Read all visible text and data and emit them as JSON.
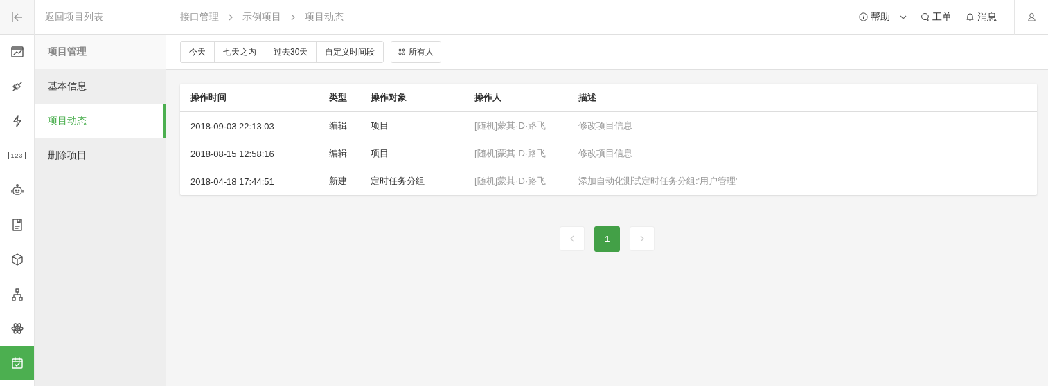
{
  "rail": {
    "items": [
      {
        "kind": "chart",
        "selected": false,
        "divider_before": false
      },
      {
        "kind": "plug",
        "selected": false,
        "divider_before": false
      },
      {
        "kind": "bolt",
        "selected": false,
        "divider_before": false
      },
      {
        "kind": "number",
        "text": "123",
        "selected": false,
        "divider_before": false
      },
      {
        "kind": "robot",
        "selected": false,
        "divider_before": false
      },
      {
        "kind": "document",
        "selected": false,
        "divider_before": false
      },
      {
        "kind": "cube",
        "selected": false,
        "divider_before": false
      },
      {
        "kind": "hierarchy",
        "selected": false,
        "divider_before": true
      },
      {
        "kind": "atom",
        "selected": false,
        "divider_before": false
      },
      {
        "kind": "calendar",
        "selected": true,
        "divider_before": false
      }
    ]
  },
  "back_link": "返回项目列表",
  "menu": {
    "title": "项目管理",
    "items": [
      {
        "label": "基本信息",
        "selected": false
      },
      {
        "label": "项目动态",
        "selected": true
      },
      {
        "label": "删除项目",
        "selected": false
      }
    ]
  },
  "breadcrumb": [
    "接口管理",
    "示例项目",
    "项目动态"
  ],
  "header_actions": [
    {
      "kind": "help",
      "label": "帮助"
    },
    {
      "kind": "ticket",
      "label": "工单"
    },
    {
      "kind": "bell",
      "label": "消息"
    }
  ],
  "filters": {
    "ranges": [
      "今天",
      "七天之内",
      "过去30天",
      "自定义时间段"
    ],
    "owner": "所有人"
  },
  "table": {
    "columns": [
      "操作时间",
      "类型",
      "操作对象",
      "操作人",
      "描述"
    ],
    "rows": [
      [
        "2018-09-03 22:13:03",
        "编辑",
        "项目",
        "[随机]蒙其·D·路飞",
        "修改项目信息"
      ],
      [
        "2018-08-15 12:58:16",
        "编辑",
        "项目",
        "[随机]蒙其·D·路飞",
        "修改项目信息"
      ],
      [
        "2018-04-18 17:44:51",
        "新建",
        "定时任务分组",
        "[随机]蒙其·D·路飞",
        "添加自动化测试定时任务分组:'用户管理'"
      ]
    ]
  },
  "pagination": {
    "pages": [
      {
        "label": "1",
        "selected": true
      }
    ]
  }
}
